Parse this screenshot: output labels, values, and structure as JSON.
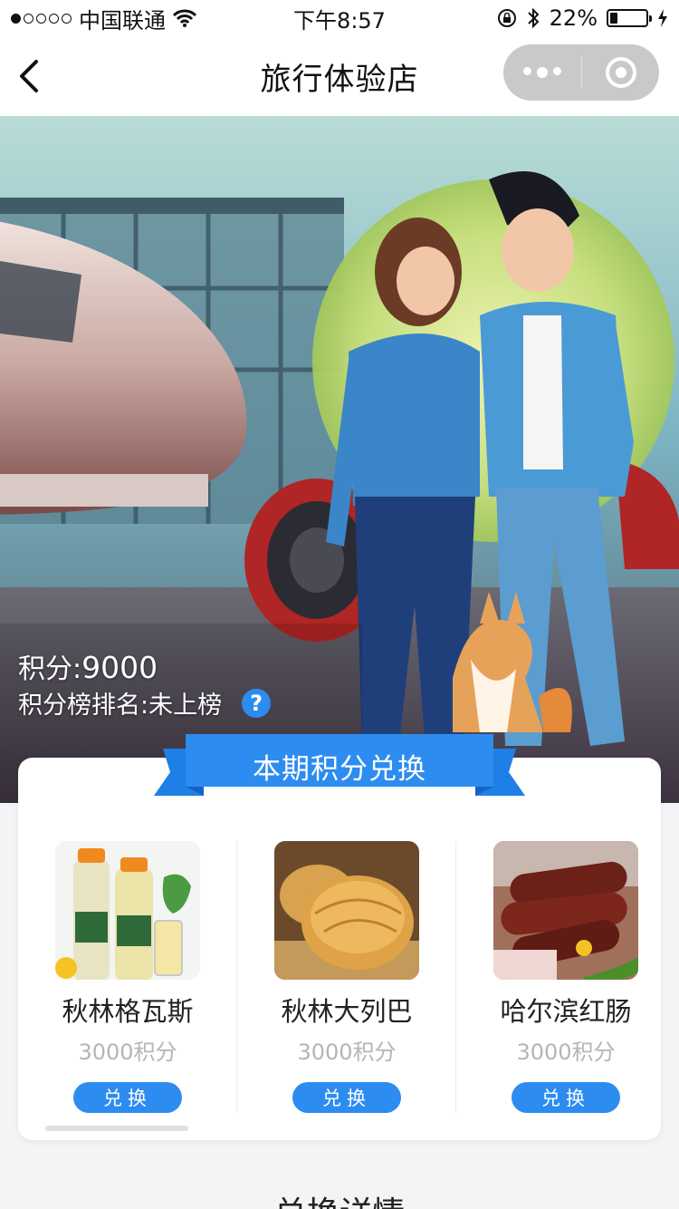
{
  "status_bar": {
    "carrier": "中国联通",
    "time": "下午8:57",
    "battery": "22%",
    "battery_level": 0.22,
    "icons": [
      "signal-dots-icon",
      "wifi-icon",
      "rotation-lock-icon",
      "bluetooth-icon",
      "battery-icon",
      "charging-icon"
    ]
  },
  "nav": {
    "title": "旅行体验店",
    "icons": [
      "back-arrow-icon",
      "more-dots-icon",
      "close-ring-icon"
    ]
  },
  "hero": {
    "points_label": "积分:",
    "points_value": "9000",
    "rank_label": "积分榜排名:未上榜",
    "help_icon": "?"
  },
  "exchange": {
    "title": "本期积分兑换",
    "products": [
      {
        "name": "秋林格瓦斯",
        "price": "3000积分",
        "button": "兑换",
        "image": "kvass-bottles"
      },
      {
        "name": "秋林大列巴",
        "price": "3000积分",
        "button": "兑换",
        "image": "bread"
      },
      {
        "name": "哈尔滨红肠",
        "price": "3000积分",
        "button": "兑换",
        "image": "red-sausage"
      }
    ]
  },
  "details": {
    "title": "兑换详情"
  },
  "colors": {
    "accent": "#2d8cf0",
    "ribbon": "#1e7fe6",
    "ribbon_dark": "#1563c2",
    "muted_text": "#b5b5b5"
  }
}
